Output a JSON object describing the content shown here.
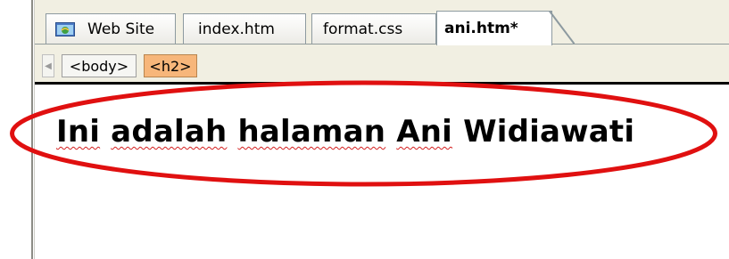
{
  "tabs": [
    {
      "label": "Web Site",
      "icon": "web-site-icon",
      "active": false
    },
    {
      "label": "index.htm",
      "active": false
    },
    {
      "label": "format.css",
      "active": false
    },
    {
      "label": "ani.htm*",
      "active": true
    }
  ],
  "tag_selector": {
    "items": [
      "<body>",
      "<h2>"
    ],
    "selected": "<h2>"
  },
  "document": {
    "heading_words": [
      "Ini",
      "adalah",
      "halaman",
      "Ani",
      "Widiawati"
    ]
  },
  "annotation": {
    "shape": "ellipse",
    "color": "#e01010"
  },
  "colors": {
    "selected_tag_bg": "#f7b67a",
    "tabbar_bg": "#f1efe2",
    "spellcheck": "#d41f1f"
  }
}
